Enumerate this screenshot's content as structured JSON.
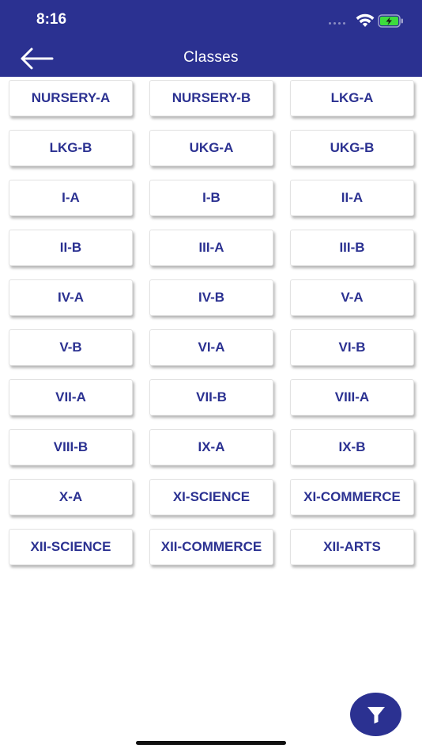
{
  "status_bar": {
    "time": "8:16"
  },
  "header": {
    "title": "Classes"
  },
  "classes": [
    "NURSERY-A",
    "NURSERY-B",
    "LKG-A",
    "LKG-B",
    "UKG-A",
    "UKG-B",
    "I-A",
    "I-B",
    "II-A",
    "II-B",
    "III-A",
    "III-B",
    "IV-A",
    "IV-B",
    "V-A",
    "V-B",
    "VI-A",
    "VI-B",
    "VII-A",
    "VII-B",
    "VIII-A",
    "VIII-B",
    "IX-A",
    "IX-B",
    "X-A",
    "XI-SCIENCE",
    "XI-COMMERCE",
    "XII-SCIENCE",
    "XII-COMMERCE",
    "XII-ARTS"
  ],
  "icons": {
    "back": "back-arrow-icon",
    "filter": "filter-icon",
    "wifi": "wifi-icon",
    "battery": "battery-charging-icon"
  },
  "colors": {
    "primary": "#2b3191",
    "background": "#ffffff",
    "battery_fill": "#3ddc3d"
  }
}
